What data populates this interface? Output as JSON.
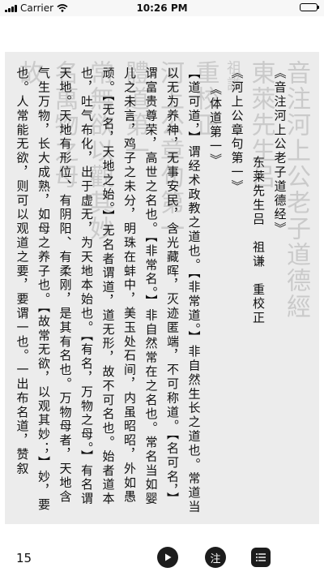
{
  "status_bar": {
    "carrier": "Carrier",
    "time": "10:26 PM"
  },
  "reader": {
    "book_title": "《音注河上公老子道德经》",
    "credit": "东莱先生吕　祖谦　重校正",
    "sub_title": "《河上公章句第一》",
    "chapter_title": "《体道第一》",
    "body": "【道可道，】谓经术政教之道也。【非常道。】非自然生长之道也。常道当以无为养神，无事安民，含光藏晖，灭迹匿端，不可称道。【名可名，】谓富贵尊荣，高世之名也。【非常名。】非自然常在之名也。常名当如婴儿之未言，鸡子之未分，明珠在蚌中，美玉处石间，内虽昭昭，外如愚顽。【无名，天地之始。】无名者谓道，道无形，故不可名也。始者道本也，吐气布化，出于虚无，为天地本始也。【有名，万物之母。】有名谓天地。天地有形位、有阴阳、有柔刚，是其有名也。万物母者，天地含气生万物，长大成熟，如母之养子也。【故常无欲，以观其妙；】妙，要也。人常能无欲，则可以观道之要，要谓一也。一出布名道，赞叙",
    "background_scan_text": [
      "音注河上公老子道德經",
      "東萊先生呂",
      "祖謙",
      "重校正",
      "河上公章句第一",
      "體道第一",
      "常無欲以觀其妙",
      "名萬物之母",
      "故"
    ]
  },
  "bottom_bar": {
    "page_number": "15",
    "play_icon": "play-icon",
    "note_label": "注",
    "toc_icon": "list-icon"
  }
}
